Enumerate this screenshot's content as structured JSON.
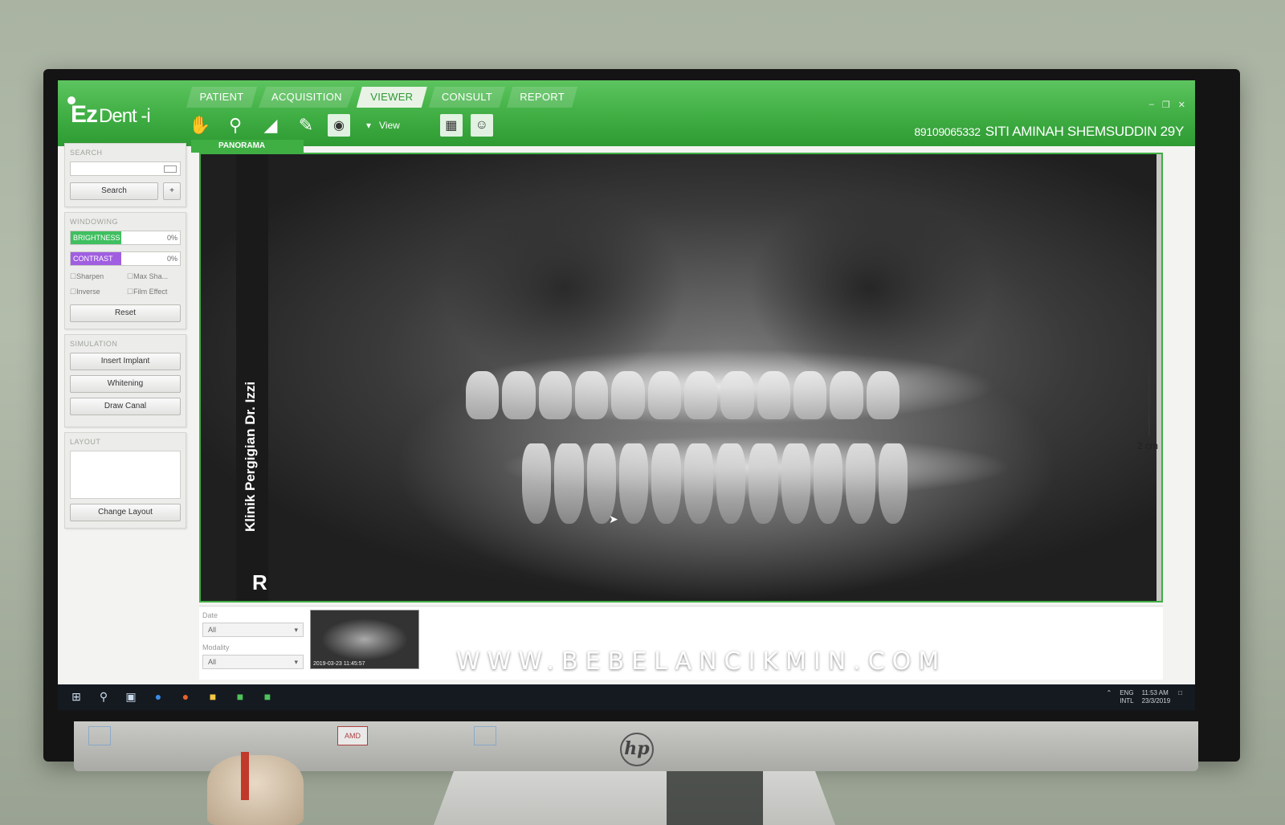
{
  "app": {
    "logo_main": "Ez",
    "logo_sub": "Dent -i",
    "patient_id": "89109065332",
    "patient_name": "SITI AMINAH SHEMSUDDIN 29Y",
    "accent": "#3fae43"
  },
  "tabs": [
    {
      "label": "PATIENT"
    },
    {
      "label": "ACQUISITION"
    },
    {
      "label": "VIEWER"
    },
    {
      "label": "CONSULT"
    },
    {
      "label": "REPORT"
    }
  ],
  "toolbar": {
    "view_label": "View",
    "icons": [
      "hand-icon",
      "magnifier-icon",
      "angle-icon",
      "pencil-icon",
      "capture-icon",
      "grid-icon",
      "face-icon"
    ]
  },
  "sidebar": {
    "search": {
      "title": "SEARCH",
      "button": "Search",
      "add": "+"
    },
    "windowing": {
      "title": "WINDOWING",
      "brightness_label": "BRIGHTNESS",
      "brightness_value": "0%",
      "contrast_label": "CONTRAST",
      "contrast_value": "0%",
      "checks": [
        "Sharpen",
        "Max Sha...",
        "Inverse",
        "Film Effect"
      ],
      "reset": "Reset"
    },
    "simulation": {
      "title": "SIMULATION",
      "buttons": [
        "Insert Implant",
        "Whitening",
        "Draw Canal"
      ]
    },
    "layout": {
      "title": "LAYOUT",
      "button": "Change Layout"
    }
  },
  "viewer": {
    "tab_label": "PANORAMA",
    "clinic": "Klinik Pergigian Dr. Izzi",
    "side_marker": "R",
    "scale_label": "2 cm"
  },
  "bottom": {
    "date_label": "Date",
    "date_value": "All",
    "modality_label": "Modality",
    "modality_value": "All",
    "thumb_caption": "2019-03-23 11:45:57"
  },
  "watermark": "WWW.BEBELANCIKMIN.COM",
  "taskbar": {
    "lang1": "ENG",
    "lang2": "INTL",
    "time": "11:53 AM",
    "date": "23/3/2019"
  },
  "monitor": {
    "brand": "hp",
    "sticker": "AMD"
  }
}
